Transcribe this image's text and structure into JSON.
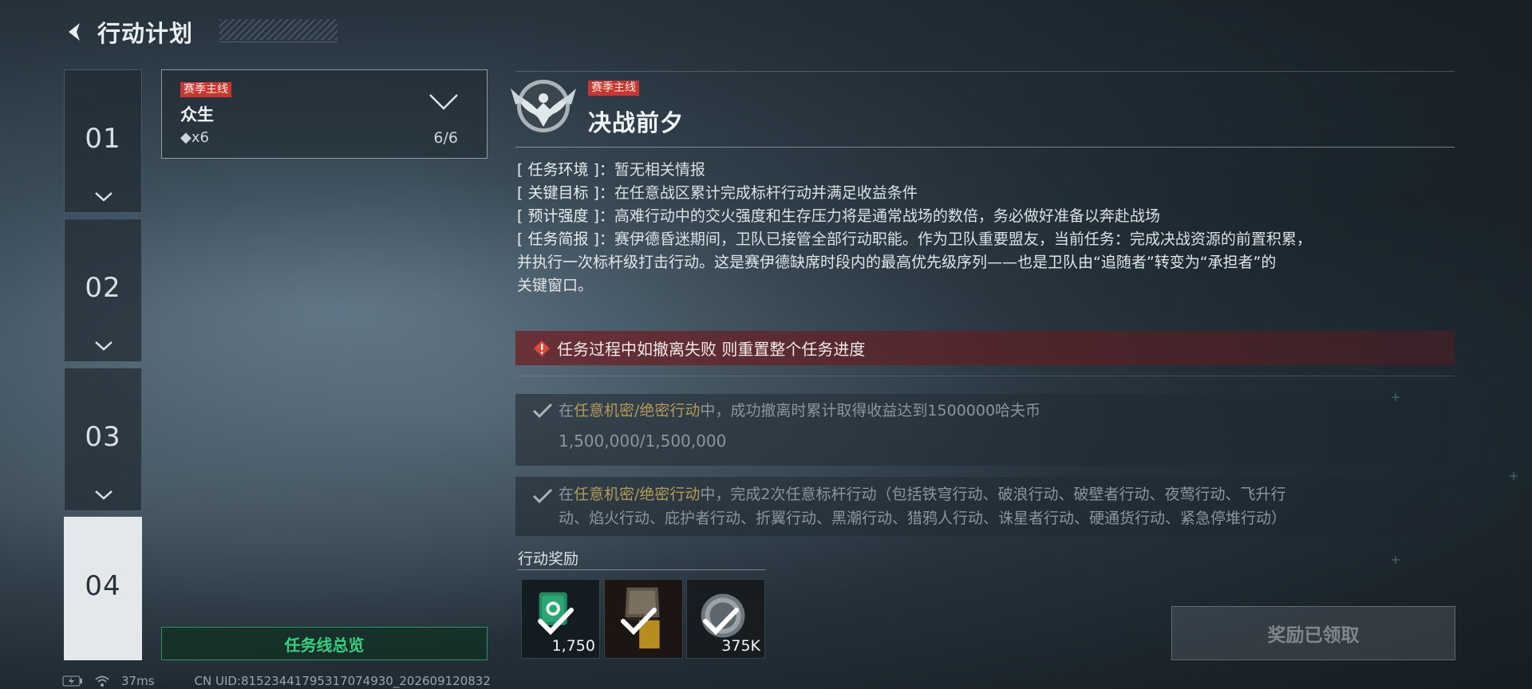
{
  "header": {
    "title": "行动计划",
    "back_icon": "back-arrow-icon"
  },
  "chapters": [
    {
      "number": "01",
      "active": false
    },
    {
      "number": "02",
      "active": false
    },
    {
      "number": "03",
      "active": false
    },
    {
      "number": "04",
      "active": true
    }
  ],
  "mission_list": {
    "tag": "赛季主线",
    "name": "众生",
    "count": "◆x6",
    "progress": "6/6"
  },
  "overview_button": "任务线总览",
  "detail": {
    "tag": "赛季主线",
    "title": "决战前夕",
    "info": [
      {
        "label": "[ 任务环境 ]：",
        "value": "暂无相关情报"
      },
      {
        "label": "[ 关键目标 ]：",
        "value": "在任意战区累计完成标杆行动并满足收益条件"
      },
      {
        "label": "[ 预计强度 ]：",
        "value": "高难行动中的交火强度和生存压力将是通常战场的数倍，务必做好准备以奔赴战场"
      },
      {
        "label": "[ 任务简报 ]：",
        "value": "赛伊德昏迷期间，卫队已接管全部行动职能。作为卫队重要盟友，当前任务：完成决战资源的前置积累，",
        "cont": "并执行一次标杆级打击行动。这是赛伊德缺席时段内的最高优先级序列——也是卫队由“追随者”转变为“承担者”的",
        "cont2": "关键窗口。"
      }
    ],
    "warning": "任务过程中如撤离失败 则重置整个任务进度",
    "objectives": [
      {
        "prefix": "在",
        "highlight": "任意机密/绝密行动",
        "suffix": "中，成功撤离时累计取得收益达到1500000哈夫币",
        "progress": "1,500,000/1,500,000"
      },
      {
        "prefix": "在",
        "highlight": "任意机密/绝密行动",
        "suffix": "中，完成2次任意标杆行动（包括铁穹行动、破浪行动、破壁者行动、夜莺行动、飞升行",
        "line2": "动、焰火行动、庇护者行动、折翼行动、黑潮行动、猎鸦人行动、诛星者行动、硬通货行动、紧急停堆行动）"
      }
    ],
    "rewards_label": "行动奖励",
    "rewards": [
      {
        "icon": "badge-icon",
        "qty": "1,750",
        "claimed": true
      },
      {
        "icon": "outfit-icon",
        "qty": "",
        "claimed": true
      },
      {
        "icon": "coin-icon",
        "qty": "375K",
        "claimed": true
      }
    ],
    "claim_button": "奖励已领取"
  },
  "status": {
    "ping": "37ms",
    "uid": "CN UID:815234417953170749​30_202609120832"
  },
  "colors": {
    "tag_red": "#c5372f",
    "overview_green": "#34d07f",
    "objective_highlight": "#b59a57",
    "warning_bg": "#6e1e22"
  }
}
